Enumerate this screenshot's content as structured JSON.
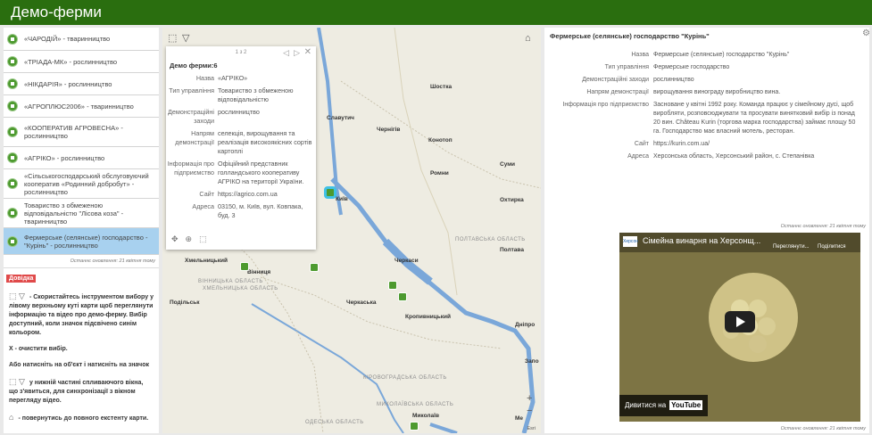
{
  "header": {
    "title": "Демо-ферми"
  },
  "list": {
    "items": [
      {
        "label": "«ЧАРОДІЙ» - тваринництво"
      },
      {
        "label": "«ТРІАДА-МК» - рослинництво"
      },
      {
        "label": "«НІКДАРІЯ» - рослинництво"
      },
      {
        "label": "«АГРОПЛЮС2006» - тваринництво"
      },
      {
        "label": "«КООПЕРАТИВ АГРОВЕСНА» - рослинництво"
      },
      {
        "label": "«АГРІКО» - рослинництво"
      },
      {
        "label": "«Сільськогосподарський обслуговуючий кооператив «Родинний добробут» - рослинництво"
      },
      {
        "label": "Товариство з обмеженою відповідальністю \"Лісова коза\" - тваринництво"
      },
      {
        "label": "Фермерське (селянське) господарство - \"Курінь\" - рослинництво"
      }
    ],
    "updated": "Останнє оновлення: 21 квітня тому"
  },
  "help": {
    "tag": "Довідка",
    "p1": "- Скористайтесь інструментом вибору у лівому верхньому куті карти щоб переглянути інформацію та відео про демо-ферму. Вибір доступний, коли значок підсвічено синім кольором.",
    "p2": "X - очистити вибір.",
    "p3": "Або натисніть на об'єкт і натисніть на значок",
    "p4": "у нижній частині спливаючого вікна, що з'явиться, для синхронізації з вікном перегляду відео.",
    "p5": "- повернутись до повного екстенту карти."
  },
  "popup": {
    "pager": "1 з 2",
    "title": "Демо ферми:6",
    "rows": [
      {
        "k": "Назва",
        "v": "«АГРІКО»"
      },
      {
        "k": "Тип управління",
        "v": "Товариство з обмеженою відповідальністю"
      },
      {
        "k": "Демонстраційні заходи",
        "v": "рослинництво"
      },
      {
        "k": "Напрям демонстрації",
        "v": "селекція, вирощування та реалізація високоякісних сортів картоплі"
      },
      {
        "k": "Інформація про підприємство",
        "v": "Офіційний представник голландського кооперативу АГРІКО на території України."
      },
      {
        "k": "Сайт",
        "v": "https://agrico.com.ua"
      },
      {
        "k": "Адреса",
        "v": "03150, м. Київ, вул. Ковпака, буд. 3"
      }
    ]
  },
  "map": {
    "cities": [
      "Шостка",
      "Чернігів",
      "Славутич",
      "Конотоп",
      "Суми",
      "Ромни",
      "Київ",
      "Охтирка",
      "Хмельницький",
      "Вінниця",
      "Черкаси",
      "Полтава",
      "Кропивницький",
      "Дніпро",
      "Запо",
      "Миколаїв",
      "Подільськ",
      "Черкаська",
      "Ме"
    ],
    "regions": [
      "ПОЛТАВСЬКА ОБЛАСТЬ",
      "ВІННИЦЬКА ОБЛАСТЬ",
      "ХМЕЛЬНИЦЬКА ОБЛАСТЬ",
      "КІРОВОГРАДСЬКА ОБЛАСТЬ",
      "МИКОЛАЇВСЬКА ОБЛАСТЬ",
      "ОДЕСЬКА ОБЛАСТЬ"
    ],
    "attribution": "Esri"
  },
  "detail": {
    "title": "Фермерське (селянське) господарство \"Курінь\"",
    "rows": [
      {
        "k": "Назва",
        "v": "Фермерське (селянське) господарство \"Курінь\""
      },
      {
        "k": "Тип управління",
        "v": "Фермерське господарство"
      },
      {
        "k": "Демонстраційні заходи",
        "v": "рослинництво"
      },
      {
        "k": "Напрям демонстрації",
        "v": "вирощування винограду виробництво вина."
      },
      {
        "k": "Інформація про підприємство",
        "v": "Засноване у квітні 1992 року. Команда працює у сімейному дусі, щоб виробляти, розповсюджувати та просувати винятковий вибір із понад 20 вин. Château Kurin (торгова марка господарства) займає площу 50 га. Господарство має власний мотель, ресторан."
      },
      {
        "k": "Сайт",
        "v": "https://kurin.com.ua/"
      },
      {
        "k": "Адреса",
        "v": "Херсонська область, Херсонський район, с. Степанівка"
      }
    ],
    "updated": "Останнє оновлення: 21 квітня тому",
    "updated2": "Останнє оновлення: 21 квітня тому"
  },
  "video": {
    "title": "Сімейна винарня на Херсонщ...",
    "share": "Поділитися",
    "watch_label": "Дивитися на",
    "yt": "YouTube",
    "channel": "Херсон",
    "later": "Переглянути..."
  }
}
